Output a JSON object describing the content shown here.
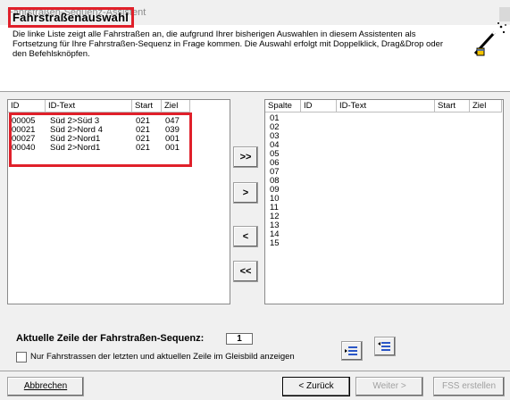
{
  "window": {
    "title": "Fahrstraßen-Sequenz-Assistent"
  },
  "header": {
    "title": "Fahrstraßenauswahl",
    "description": "Die linke Liste zeigt alle Fahrstraßen an, die aufgrund Ihrer bisherigen Auswahlen in diesem Assistenten als Fortsetzung für Ihre Fahrstraßen-Sequenz in Frage kommen. Die Auswahl erfolgt mit Doppelklick, Drag&Drop oder den Befehlsknöpfen.",
    "icon": "magic-wand-icon"
  },
  "left_list": {
    "columns": [
      "ID",
      "ID-Text",
      "Start",
      "Ziel"
    ],
    "rows": [
      [
        "00005",
        "Süd 2>Süd 3",
        "021",
        "047"
      ],
      [
        "00021",
        "Süd 2>Nord 4",
        "021",
        "039"
      ],
      [
        "00027",
        "Süd 2>Nord1",
        "021",
        "001"
      ],
      [
        "00040",
        "Süd 2>Nord1",
        "021",
        "001"
      ]
    ]
  },
  "move_buttons": {
    "add_all": ">>",
    "add": ">",
    "remove": "<",
    "remove_all": "<<"
  },
  "right_list": {
    "columns": [
      "Spalte",
      "ID",
      "ID-Text",
      "Start",
      "Ziel"
    ],
    "rows": [
      "01",
      "02",
      "03",
      "04",
      "05",
      "06",
      "07",
      "08",
      "09",
      "10",
      "11",
      "12",
      "13",
      "14",
      "15"
    ]
  },
  "bottom": {
    "current_row_label": "Aktuelle Zeile der Fahrstraßen-Sequenz:",
    "current_row_value": "1",
    "checkbox_label": "Nur Fahrstrassen der letzten und aktuellen Zeile im Gleisbild anzeigen",
    "checkbox_checked": false
  },
  "footer": {
    "cancel": "Abbrechen",
    "back": "< Zurück",
    "next": "Weiter >",
    "finish": "FSS erstellen"
  },
  "colors": {
    "highlight": "#e0202a",
    "background": "#f0f0f0"
  }
}
